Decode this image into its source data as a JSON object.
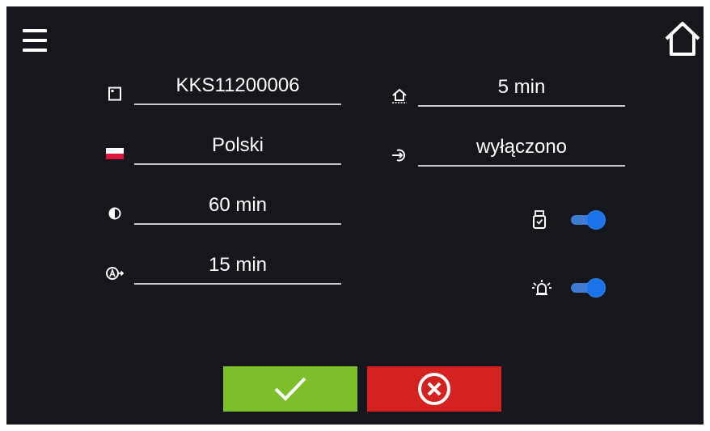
{
  "left_fields": [
    {
      "icon": "device-id-icon",
      "value": "KKS11200006"
    },
    {
      "icon": "language-flag-icon",
      "value": "Polski"
    },
    {
      "icon": "brightness-icon",
      "value": "60 min"
    },
    {
      "icon": "auto-logout-icon",
      "value": "15 min"
    }
  ],
  "right_fields": [
    {
      "icon": "home-return-icon",
      "value": "5 min"
    },
    {
      "icon": "login-icon",
      "value": "wyłączono"
    }
  ],
  "toggles": [
    {
      "icon": "usb-icon",
      "state": "on"
    },
    {
      "icon": "alarm-icon",
      "state": "on"
    }
  ],
  "colors": {
    "background": "#16171c",
    "confirm": "#7dbf2a",
    "cancel": "#d32220",
    "toggle": "#1a73e8"
  }
}
